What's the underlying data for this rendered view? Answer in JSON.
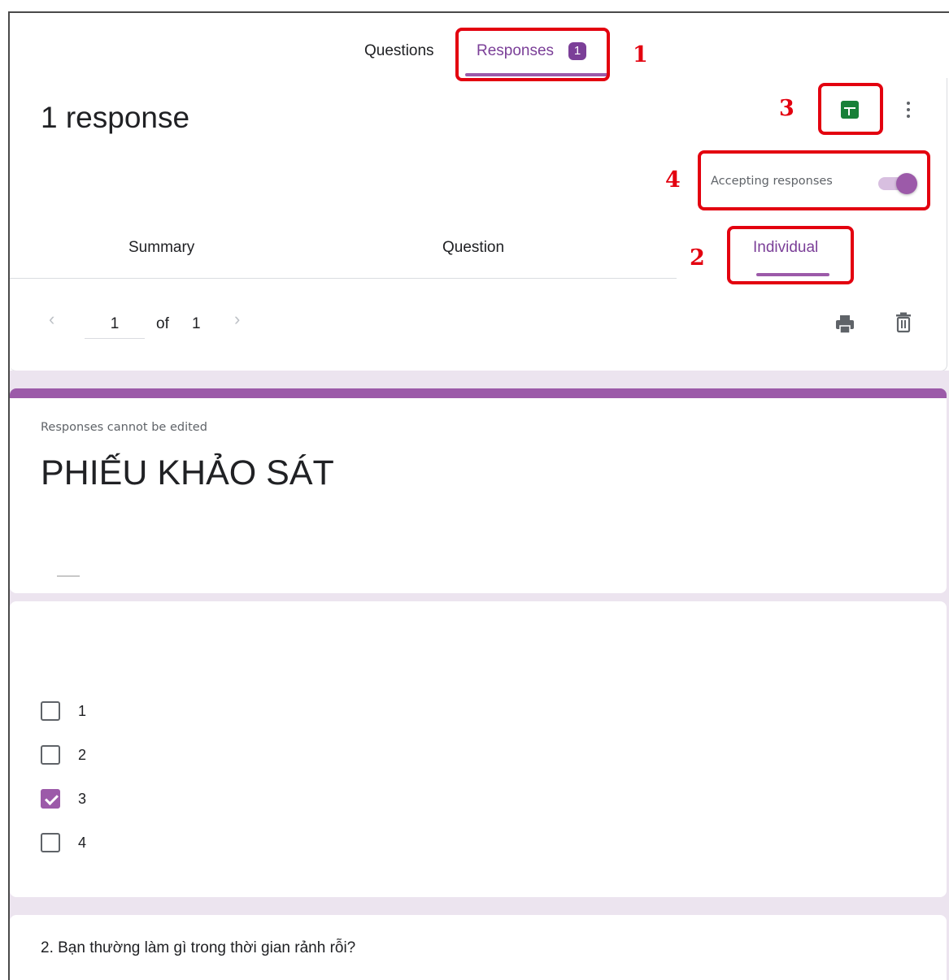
{
  "tabs": {
    "questions": "Questions",
    "responses": "Responses",
    "responses_badge": "1"
  },
  "header": {
    "count_title": "1 response",
    "accepting_label": "Accepting responses",
    "accepting_on": true
  },
  "sub_tabs": {
    "summary": "Summary",
    "question": "Question",
    "individual": "Individual"
  },
  "pager": {
    "prev": "‹",
    "current": "1",
    "of": "of",
    "total": "1",
    "next": "›"
  },
  "form": {
    "notice": "Responses cannot be edited",
    "title": "PHIẾU KHẢO SÁT"
  },
  "question_1": {
    "options": [
      {
        "label": "1",
        "checked": false
      },
      {
        "label": "2",
        "checked": false
      },
      {
        "label": "3",
        "checked": true
      },
      {
        "label": "4",
        "checked": false
      }
    ]
  },
  "question_2": {
    "text": "2. Bạn thường làm gì trong thời gian rảnh rỗi?"
  },
  "callouts": [
    "1",
    "2",
    "3",
    "4"
  ],
  "colors": {
    "accent": "#9c5aa9",
    "accent_dark": "#7b3f98",
    "sheets_green": "#188038",
    "callout_red": "#e3000f",
    "page_bg": "#ece4ef"
  },
  "icons": [
    "spreadsheet-icon",
    "more-vert-icon",
    "print-icon",
    "trash-icon",
    "chevron-left-icon",
    "chevron-right-icon",
    "check-icon"
  ]
}
